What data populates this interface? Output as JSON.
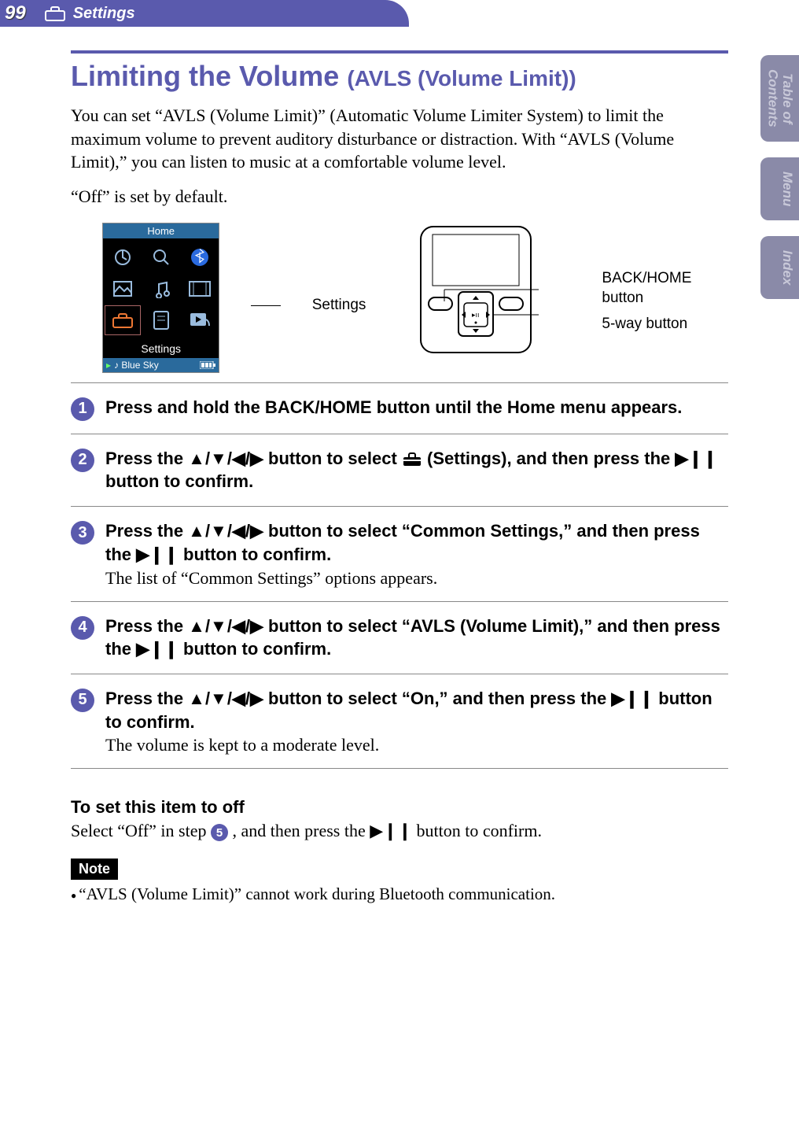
{
  "header": {
    "page_number": "99",
    "section": "Settings"
  },
  "tabs": {
    "toc": "Table of\nContents",
    "menu": "Menu",
    "index": "Index"
  },
  "title": {
    "main": "Limiting the Volume",
    "sub": "(AVLS (Volume Limit))"
  },
  "intro": "You can set “AVLS (Volume Limit)” (Automatic Volume Limiter System) to limit the maximum volume to prevent auditory disturbance or distraction. With “AVLS (Volume Limit),” you can listen to music at a comfortable volume level.",
  "intro2": "“Off” is set by default.",
  "figure": {
    "screen_title": "Home",
    "screen_selected": "Settings",
    "now_playing": "♪ Blue Sky",
    "settings_label": "Settings",
    "callout_back": "BACK/HOME button",
    "callout_5way": "5-way button"
  },
  "steps": [
    {
      "num": "1",
      "title": "Press and hold the BACK/HOME button until the Home menu appears."
    },
    {
      "num": "2",
      "title_parts": {
        "a": "Press the ▲/▼/◀/▶ button to select ",
        "b": " (Settings), and then press the ▶❙❙ button to confirm."
      }
    },
    {
      "num": "3",
      "title": "Press the ▲/▼/◀/▶ button to select “Common Settings,” and then press the ▶❙❙ button to confirm.",
      "desc": "The list of “Common Settings” options appears."
    },
    {
      "num": "4",
      "title": "Press the ▲/▼/◀/▶ button to select “AVLS (Volume Limit),” and then press the ▶❙❙ button to confirm."
    },
    {
      "num": "5",
      "title": "Press the ▲/▼/◀/▶ button to select “On,” and then press the ▶❙❙ button to confirm.",
      "desc": "The volume is kept to a moderate level."
    }
  ],
  "subheading": "To set this item to off",
  "sub_text_a": "Select “Off” in step ",
  "sub_step_ref": "5",
  "sub_text_b": ", and then press the ▶❙❙ button to confirm.",
  "note_label": "Note",
  "notes": [
    "“AVLS (Volume Limit)” cannot work during Bluetooth communication."
  ]
}
